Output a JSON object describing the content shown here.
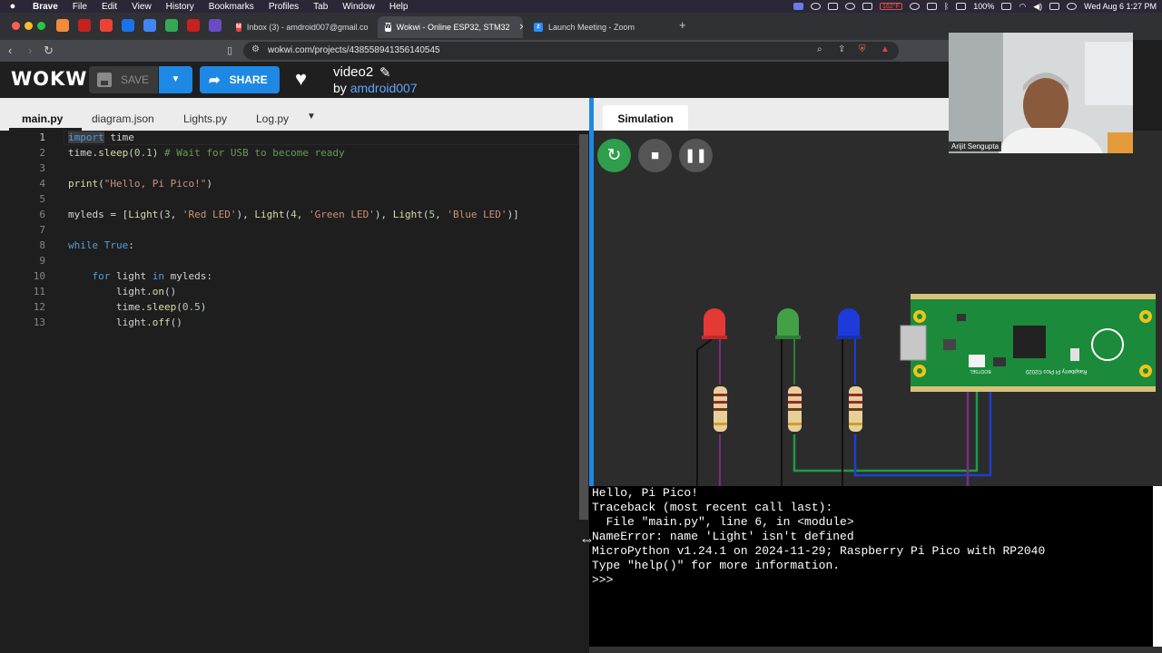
{
  "menubar": {
    "app": "Brave",
    "items": [
      "File",
      "Edit",
      "View",
      "History",
      "Bookmarks",
      "Profiles",
      "Tab",
      "Window",
      "Help"
    ],
    "battery": "100%",
    "temp": "162°F",
    "datetime": "Wed Aug 6  1:27 PM"
  },
  "tabs": [
    {
      "title": "Inbox (3) - amdroid007@gmail.co",
      "icon": "gmail-icon",
      "color": "#ea4335",
      "active": false
    },
    {
      "title": "Wokwi - Online ESP32, STM32",
      "icon": "wokwi-icon",
      "color": "#ffffff",
      "active": true
    },
    {
      "title": "Launch Meeting - Zoom",
      "icon": "zoom-icon",
      "color": "#2d8cff",
      "active": false
    }
  ],
  "pinned_colors": [
    "#f28b3b",
    "#c5221f",
    "#ea4335",
    "#1a73e8",
    "#4285f4",
    "#34a853",
    "#c5221f",
    "#6a4cc2",
    "#ea4335"
  ],
  "address": {
    "url": "wokwi.com/projects/438558941356140545",
    "shield_count": "2"
  },
  "header": {
    "logo": "WOKWI",
    "save_label": "SAVE",
    "share_label": "SHARE",
    "project_title": "video2",
    "by_prefix": "by ",
    "author": "amdroid007"
  },
  "editor": {
    "tabs": [
      "main.py",
      "diagram.json",
      "Lights.py",
      "Log.py"
    ],
    "active_tab": "main.py",
    "lines": [
      "1",
      "2",
      "3",
      "4",
      "5",
      "6",
      "7",
      "8",
      "9",
      "10",
      "11",
      "12",
      "13"
    ]
  },
  "simulation": {
    "tab_label": "Simulation",
    "board_label": "Raspberry Pi Pico ©2020",
    "bootsel": "BOOTSEL",
    "led_colors": [
      "#e53935",
      "#43a047",
      "#1e3adb"
    ]
  },
  "serial": {
    "lines": [
      "Hello, Pi Pico!",
      "Traceback (most recent call last):",
      "  File \"main.py\", line 6, in <module>",
      "NameError: name 'Light' isn't defined",
      "MicroPython v1.24.1 on 2024-11-29; Raspberry Pi Pico with RP2040",
      "Type \"help()\" for more information.",
      ">>> "
    ]
  },
  "zoom": {
    "participant": "Arijit Sengupta"
  }
}
